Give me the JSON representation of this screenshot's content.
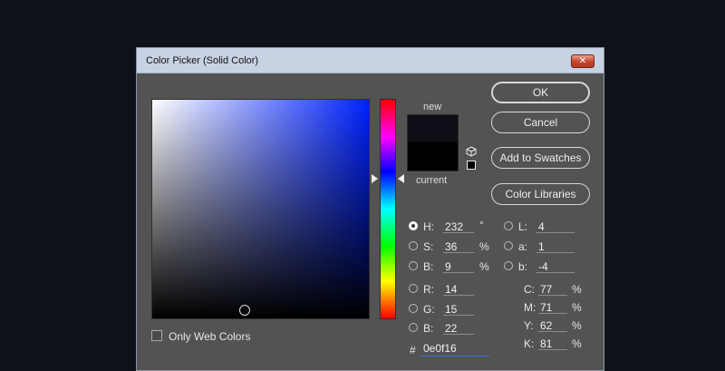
{
  "dialog": {
    "title": "Color Picker (Solid Color)",
    "close_symbol": "✕"
  },
  "swatches": {
    "new_label": "new",
    "current_label": "current",
    "new_color": "#0e0f16",
    "current_color": "#000000"
  },
  "buttons": {
    "ok": "OK",
    "cancel": "Cancel",
    "add_to_swatches": "Add to Swatches",
    "color_libraries": "Color Libraries"
  },
  "hsb": {
    "h_label": "H:",
    "h_value": "232",
    "h_unit": "°",
    "s_label": "S:",
    "s_value": "36",
    "s_unit": "%",
    "b_label": "B:",
    "b_value": "9",
    "b_unit": "%"
  },
  "rgb": {
    "r_label": "R:",
    "r_value": "14",
    "g_label": "G:",
    "g_value": "15",
    "b_label": "B:",
    "b_value": "22"
  },
  "lab": {
    "l_label": "L:",
    "l_value": "4",
    "a_label": "a:",
    "a_value": "1",
    "b_label": "b:",
    "b_value": "-4"
  },
  "cmyk": {
    "c_label": "C:",
    "c_value": "77",
    "c_unit": "%",
    "m_label": "M:",
    "m_value": "71",
    "m_unit": "%",
    "y_label": "Y:",
    "y_value": "62",
    "y_unit": "%",
    "k_label": "K:",
    "k_value": "81",
    "k_unit": "%"
  },
  "hex": {
    "hash": "#",
    "value": "0e0f16"
  },
  "web_colors": {
    "label": "Only Web Colors",
    "checked": false
  }
}
